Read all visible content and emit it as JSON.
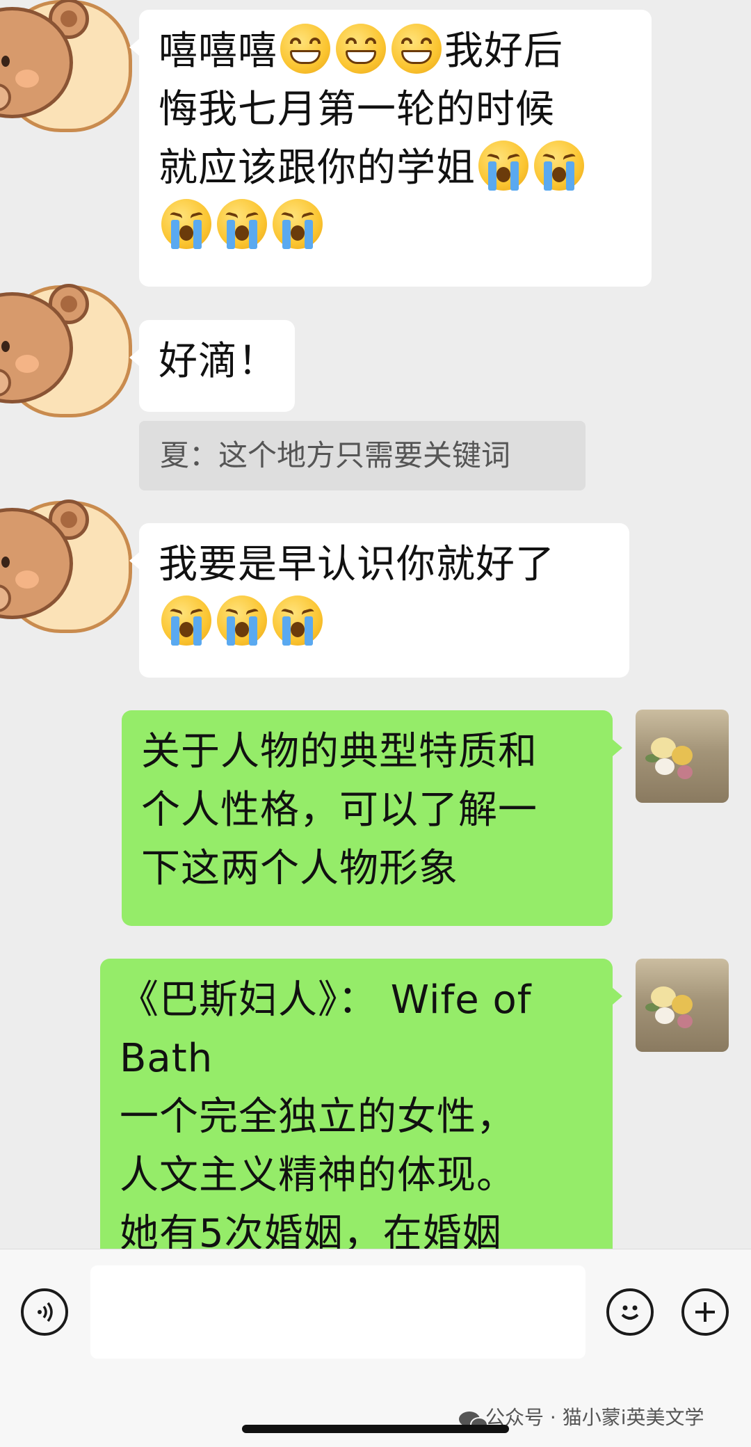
{
  "messages": [
    {
      "side": "left",
      "lines": [
        "嘻嘻嘻😁😁😁我好后",
        "悔我七月第一轮的时候",
        "就应该跟你的学姐😭😭",
        "😭😭😭"
      ]
    },
    {
      "side": "left",
      "lines": [
        "好滴！"
      ]
    },
    {
      "quote": "夏：这个地方只需要关键词"
    },
    {
      "side": "left",
      "lines": [
        "我要是早认识你就好了",
        "😭😭😭"
      ]
    },
    {
      "side": "right",
      "lines": [
        "关于人物的典型特质和",
        "个人性格，可以了解一",
        "下这两个人物形象"
      ]
    },
    {
      "side": "right",
      "lines": [
        "《巴斯妇人》： Wife of",
        "Bath",
        "一个完全独立的女性，",
        "人文主义精神的体现。",
        "她有5次婚姻，在婚姻"
      ]
    }
  ],
  "m1": {
    "a": "嘻嘻嘻",
    "b": "我好后",
    "l2": "悔我七月第一轮的时候",
    "l3": "就应该跟你的学姐"
  },
  "m2": {
    "l1": "好滴！"
  },
  "quote": "夏：这个地方只需要关键词",
  "m3": {
    "l1": "我要是早认识你就好了"
  },
  "m4": {
    "l1": "关于人物的典型特质和",
    "l2": "个人性格，可以了解一",
    "l3": "下这两个人物形象"
  },
  "m5": {
    "l1": "《巴斯妇人》： Wife of",
    "l2": "Bath",
    "l3": "一个完全独立的女性，",
    "l4": "人文主义精神的体现。",
    "l5": "她有5次婚姻，在婚姻"
  },
  "input": {
    "voice_icon": "voice-icon",
    "emoji_icon": "smiley-icon",
    "plus_icon": "plus-icon"
  },
  "watermark": "公众号 · 猫小蒙i英美文学",
  "colors": {
    "background": "#ededed",
    "self_bubble": "#95ec69",
    "other_bubble": "#ffffff"
  }
}
